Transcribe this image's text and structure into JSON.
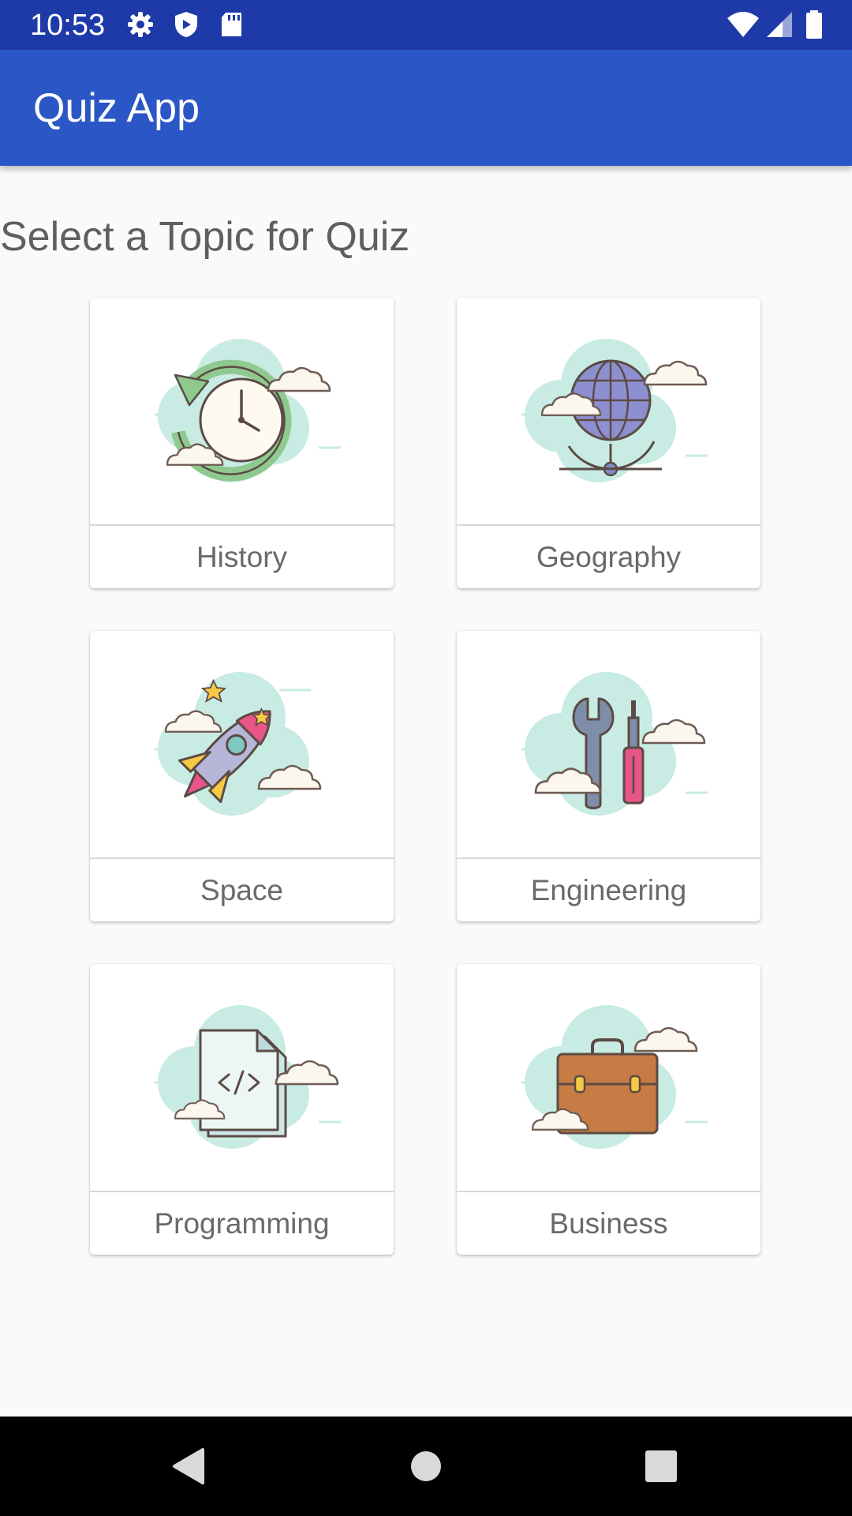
{
  "status_bar": {
    "time": "10:53",
    "icons": [
      "gear-icon",
      "shield-icon",
      "sd-card-icon",
      "wifi-icon",
      "signal-icon",
      "battery-icon"
    ],
    "color": "#1e3aa8"
  },
  "app_bar": {
    "title": "Quiz App",
    "color": "#2b57c6"
  },
  "main": {
    "heading": "Select a Topic for Quiz",
    "topics": [
      {
        "label": "History",
        "icon": "clock-history-icon"
      },
      {
        "label": "Geography",
        "icon": "globe-icon"
      },
      {
        "label": "Space",
        "icon": "rocket-icon"
      },
      {
        "label": "Engineering",
        "icon": "tools-icon"
      },
      {
        "label": "Programming",
        "icon": "code-file-icon"
      },
      {
        "label": "Business",
        "icon": "briefcase-icon"
      }
    ]
  },
  "nav_bar": {
    "icons": [
      "back-icon",
      "home-icon",
      "recents-icon"
    ]
  },
  "colors": {
    "cloud": "#c8ebe3",
    "accent_blue": "#2b57c6",
    "text_gray": "#6a6a6a"
  }
}
